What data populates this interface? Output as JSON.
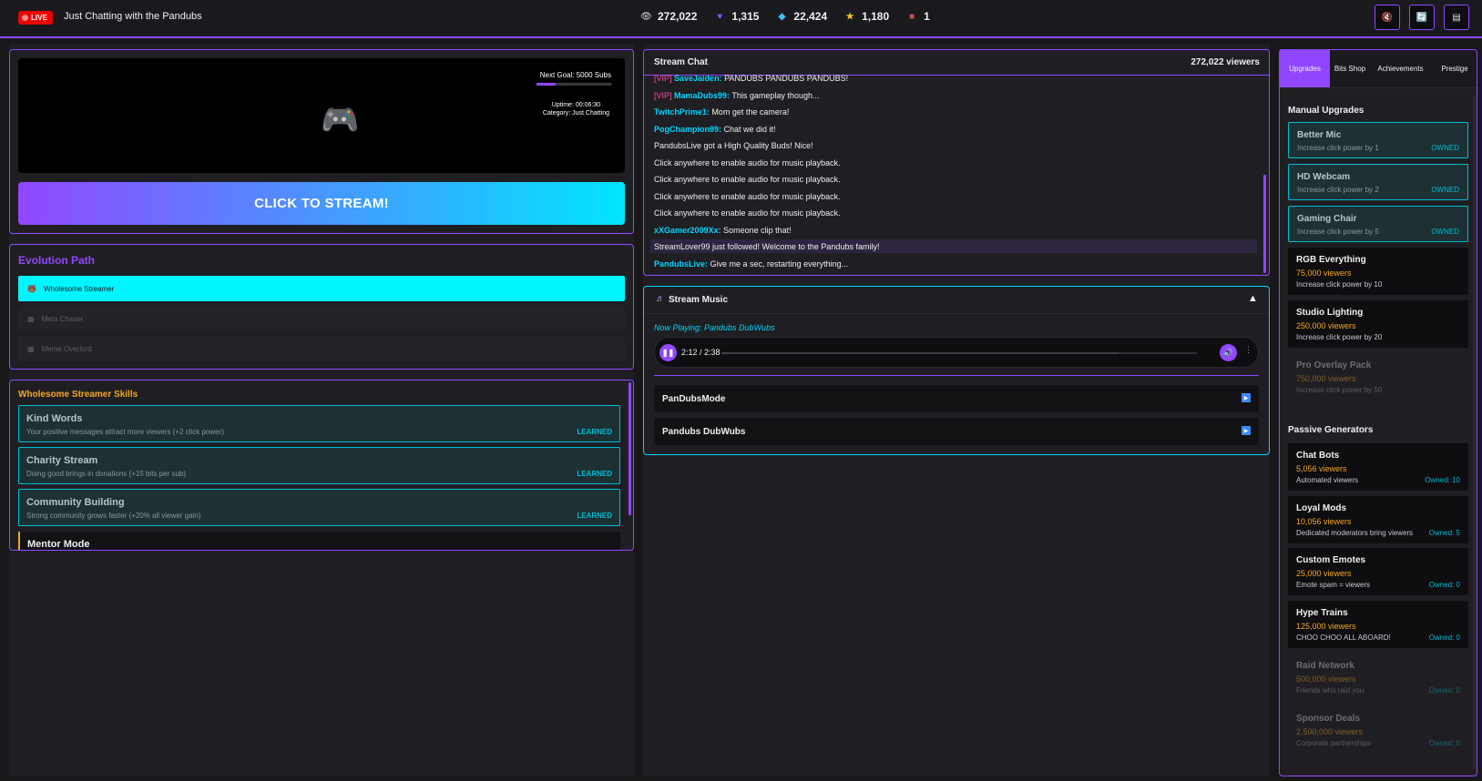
{
  "header": {
    "live_label": "LIVE",
    "title": "Just Chatting with the Pandubs",
    "stats": [
      {
        "icon": "eye-icon",
        "value": "272,022"
      },
      {
        "icon": "heart-icon",
        "value": "1,315"
      },
      {
        "icon": "diamond-icon",
        "value": "22,424"
      },
      {
        "icon": "star-icon",
        "value": "1,180"
      },
      {
        "icon": "briefcase-icon",
        "value": "1"
      }
    ],
    "buttons": [
      "mute-icon",
      "refresh-icon",
      "save-icon"
    ]
  },
  "stream": {
    "goal_label": "Next Goal: 5000 Subs",
    "goal_progress": 0.26,
    "uptime": "Uptime: 00:06:30",
    "category": "Category: Just Chatting",
    "click_button": "CLICK TO STREAM!"
  },
  "evolution": {
    "title": "Evolution Path",
    "items": [
      {
        "label": "Wholesome Streamer",
        "icon": "bear-icon",
        "active": true
      },
      {
        "label": "Meta Chaser",
        "icon": "lock-icon",
        "active": false
      },
      {
        "label": "Meme Overlord",
        "icon": "lock-icon",
        "active": false
      }
    ]
  },
  "skills": {
    "title": "Wholesome Streamer Skills",
    "items": [
      {
        "name": "Kind Words",
        "desc": "Your positive messages attract more viewers (+2 click power)",
        "status": "LEARNED"
      },
      {
        "name": "Charity Stream",
        "desc": "Doing good brings in donations (+15 bits per sub)",
        "status": "LEARNED"
      },
      {
        "name": "Community Building",
        "desc": "Strong community grows faster (+20% all viewer gain)",
        "status": "LEARNED"
      },
      {
        "name": "Mentor Mode",
        "desc": "",
        "status": ""
      }
    ]
  },
  "chat": {
    "title": "Stream Chat",
    "viewers": "272,022 viewers",
    "messages": [
      {
        "vip": "[VIP]",
        "user": "SaveJaiden:",
        "text": "PANDUBS PANDUBS PANDUBS!"
      },
      {
        "vip": "[VIP]",
        "user": "MamaDubs99:",
        "text": "This gameplay though..."
      },
      {
        "vip": "",
        "user": "TwitchPrime1:",
        "text": "Mom get the camera!"
      },
      {
        "vip": "",
        "user": "PogChampion99:",
        "text": "Chat we did it!"
      },
      {
        "vip": "",
        "user": "",
        "text": "PandubsLive got a High Quality Buds! Nice!"
      },
      {
        "vip": "",
        "user": "",
        "text": "Click anywhere to enable audio for music playback."
      },
      {
        "vip": "",
        "user": "",
        "text": "Click anywhere to enable audio for music playback."
      },
      {
        "vip": "",
        "user": "",
        "text": "Click anywhere to enable audio for music playback."
      },
      {
        "vip": "",
        "user": "",
        "text": "Click anywhere to enable audio for music playback."
      },
      {
        "vip": "",
        "user": "xXGamer2009Xx:",
        "text": "Someone clip that!"
      },
      {
        "vip": "",
        "user": "",
        "text": "StreamLover99 just followed! Welcome to the Pandubs family!"
      },
      {
        "vip": "",
        "user": "PandubsLive:",
        "text": "Give me a sec, restarting everything..."
      }
    ]
  },
  "music": {
    "title": "Stream Music",
    "collapse": "▲",
    "now_playing": "Now Playing: Pandubs DubWubs",
    "time": "2:12 / 2:38",
    "progress": 0.835,
    "tracks": [
      "PanDubsMode",
      "Pandubs DubWubs"
    ]
  },
  "tabs": [
    "Upgrades",
    "Bits Shop",
    "Achievements",
    "Prestige"
  ],
  "manual": {
    "title": "Manual Upgrades",
    "items": [
      {
        "name": "Better Mic",
        "cost": "",
        "desc": "Increase click power by 1",
        "status": "OWNED"
      },
      {
        "name": "HD Webcam",
        "cost": "",
        "desc": "Increase click power by 2",
        "status": "OWNED"
      },
      {
        "name": "Gaming Chair",
        "cost": "",
        "desc": "Increase click power by 5",
        "status": "OWNED"
      },
      {
        "name": "RGB Everything",
        "cost": "75,000 viewers",
        "desc": "Increase click power by 10",
        "status": ""
      },
      {
        "name": "Studio Lighting",
        "cost": "250,000 viewers",
        "desc": "Increase click power by 20",
        "status": ""
      },
      {
        "name": "Pro Overlay Pack",
        "cost": "750,000 viewers",
        "desc": "Increase click power by 50",
        "status": ""
      }
    ]
  },
  "passive": {
    "title": "Passive Generators",
    "items": [
      {
        "name": "Chat Bots",
        "cost": "5,056 viewers",
        "desc": "Automated viewers",
        "owned": "Owned: 10"
      },
      {
        "name": "Loyal Mods",
        "cost": "10,056 viewers",
        "desc": "Dedicated moderators bring viewers",
        "owned": "Owned: 5"
      },
      {
        "name": "Custom Emotes",
        "cost": "25,000 viewers",
        "desc": "Emote spam = viewers",
        "owned": "Owned: 0"
      },
      {
        "name": "Hype Trains",
        "cost": "125,000 viewers",
        "desc": "CHOO CHOO ALL ABOARD!",
        "owned": "Owned: 0"
      },
      {
        "name": "Raid Network",
        "cost": "500,000 viewers",
        "desc": "Friends who raid you",
        "owned": "Owned: 0"
      },
      {
        "name": "Sponsor Deals",
        "cost": "2,500,000 viewers",
        "desc": "Corporate partnerships",
        "owned": "Owned: 0"
      }
    ]
  }
}
